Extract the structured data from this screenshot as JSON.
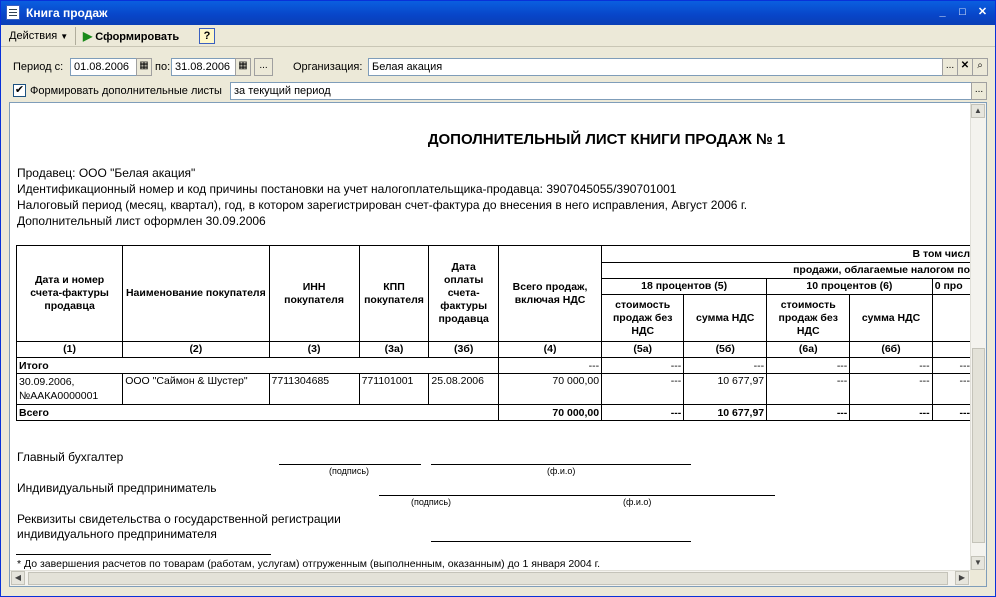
{
  "window": {
    "title": "Книга продаж"
  },
  "toolbar": {
    "actions_label": "Действия",
    "generate_label": "Сформировать",
    "help_label": "?"
  },
  "filters": {
    "period_from_label": "Период с:",
    "period_from": "01.08.2006",
    "period_to_label": "по:",
    "period_to": "31.08.2006",
    "org_label": "Организация:",
    "org_value": "Белая акация",
    "extra_sheets_label": "Формировать дополнительные листы",
    "extra_sheets_value": "за текущий период",
    "ellipsis": "...",
    "clear": "✕"
  },
  "report": {
    "heading": "ДОПОЛНИТЕЛЬНЫЙ  ЛИСТ  КНИГИ ПРОДАЖ  № 1",
    "seller": "Продавец:  ООО \"Белая акация\"",
    "inn_kpp": "Идентификационный номер и код причины постановки на учет налогоплательщика-продавца:  3907045055/390701001",
    "tax_period": "Налоговый период (месяц, квартал), год, в котором зарегистрирован счет-фактура до внесения в него исправления, Август 2006 г.",
    "issued": "Дополнительный лист оформлен 30.09.2006",
    "columns": {
      "c1": "Дата и номер счета-фактуры продавца",
      "c2": "Наименование покупателя",
      "c3": "ИНН покупателя",
      "c3a": "КПП покупателя",
      "c3b": "Дата оплаты счета-фактуры продавца",
      "c4": "Всего продаж, включая НДС",
      "incl": "В том числ",
      "taxed": "продажи, облагаемые налогом по",
      "p18": "18 процентов (5)",
      "p10": "10 процентов (6)",
      "p0": "0 про",
      "cost_nov": "стоимость продаж без НДС",
      "vat_sum": "сумма НДС"
    },
    "col_nums": [
      "(1)",
      "(2)",
      "(3)",
      "(3а)",
      "(3б)",
      "(4)",
      "(5а)",
      "(5б)",
      "(6а)",
      "(6б)",
      ""
    ],
    "total_label": "Итого",
    "dash": "---",
    "row": {
      "date_num": "30.09.2006, №ААКА0000001",
      "buyer": "ООО \"Саймон & Шустер\"",
      "inn": "7711304685",
      "kpp": "771101001",
      "paid": "25.08.2006",
      "total": "70 000,00",
      "vat18": "10 677,97"
    },
    "grand_label": "Всего",
    "grand_total": "70 000,00",
    "grand_vat18": "10 677,97",
    "chief_acc": "Главный бухгалтер",
    "entrepreneur": "Индивидуальный предприниматель",
    "cert1": "Реквизиты свидетельства о государственной регистрации",
    "cert2": "индивидуального предпринимателя",
    "sign": "(подпись)",
    "fio": "(ф.и.о)",
    "footnote": "* До завершения расчетов по товарам (работам, услугам) отгруженным (выполненным, оказанным) до 1 января 2004 г."
  }
}
